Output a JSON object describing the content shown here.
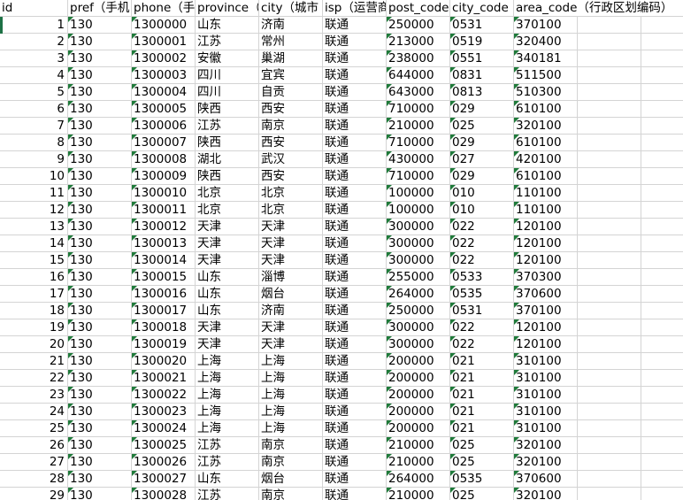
{
  "columns": [
    {
      "key": "id",
      "label": "id"
    },
    {
      "key": "pref",
      "label": "pref（手机"
    },
    {
      "key": "phone",
      "label": "phone（手"
    },
    {
      "key": "province",
      "label": "province（"
    },
    {
      "key": "city",
      "label": "city（城市"
    },
    {
      "key": "isp",
      "label": "isp（运营商"
    },
    {
      "key": "post_code",
      "label": "post_code"
    },
    {
      "key": "city_code",
      "label": "city_code（"
    },
    {
      "key": "area_code",
      "label": "area_code（行政区划编码）"
    },
    {
      "key": "extra1",
      "label": ""
    },
    {
      "key": "extra2",
      "label": ""
    }
  ],
  "rows": [
    [
      "1",
      "130",
      "1300000",
      "山东",
      "济南",
      "联通",
      "250000",
      "0531",
      "370100"
    ],
    [
      "2",
      "130",
      "1300001",
      "江苏",
      "常州",
      "联通",
      "213000",
      "0519",
      "320400"
    ],
    [
      "3",
      "130",
      "1300002",
      "安徽",
      "巢湖",
      "联通",
      "238000",
      "0551",
      "340181"
    ],
    [
      "4",
      "130",
      "1300003",
      "四川",
      "宜宾",
      "联通",
      "644000",
      "0831",
      "511500"
    ],
    [
      "5",
      "130",
      "1300004",
      "四川",
      "自贡",
      "联通",
      "643000",
      "0813",
      "510300"
    ],
    [
      "6",
      "130",
      "1300005",
      "陕西",
      "西安",
      "联通",
      "710000",
      "029",
      "610100"
    ],
    [
      "7",
      "130",
      "1300006",
      "江苏",
      "南京",
      "联通",
      "210000",
      "025",
      "320100"
    ],
    [
      "8",
      "130",
      "1300007",
      "陕西",
      "西安",
      "联通",
      "710000",
      "029",
      "610100"
    ],
    [
      "9",
      "130",
      "1300008",
      "湖北",
      "武汉",
      "联通",
      "430000",
      "027",
      "420100"
    ],
    [
      "10",
      "130",
      "1300009",
      "陕西",
      "西安",
      "联通",
      "710000",
      "029",
      "610100"
    ],
    [
      "11",
      "130",
      "1300010",
      "北京",
      "北京",
      "联通",
      "100000",
      "010",
      "110100"
    ],
    [
      "12",
      "130",
      "1300011",
      "北京",
      "北京",
      "联通",
      "100000",
      "010",
      "110100"
    ],
    [
      "13",
      "130",
      "1300012",
      "天津",
      "天津",
      "联通",
      "300000",
      "022",
      "120100"
    ],
    [
      "14",
      "130",
      "1300013",
      "天津",
      "天津",
      "联通",
      "300000",
      "022",
      "120100"
    ],
    [
      "15",
      "130",
      "1300014",
      "天津",
      "天津",
      "联通",
      "300000",
      "022",
      "120100"
    ],
    [
      "16",
      "130",
      "1300015",
      "山东",
      "淄博",
      "联通",
      "255000",
      "0533",
      "370300"
    ],
    [
      "17",
      "130",
      "1300016",
      "山东",
      "烟台",
      "联通",
      "264000",
      "0535",
      "370600"
    ],
    [
      "18",
      "130",
      "1300017",
      "山东",
      "济南",
      "联通",
      "250000",
      "0531",
      "370100"
    ],
    [
      "19",
      "130",
      "1300018",
      "天津",
      "天津",
      "联通",
      "300000",
      "022",
      "120100"
    ],
    [
      "20",
      "130",
      "1300019",
      "天津",
      "天津",
      "联通",
      "300000",
      "022",
      "120100"
    ],
    [
      "21",
      "130",
      "1300020",
      "上海",
      "上海",
      "联通",
      "200000",
      "021",
      "310100"
    ],
    [
      "22",
      "130",
      "1300021",
      "上海",
      "上海",
      "联通",
      "200000",
      "021",
      "310100"
    ],
    [
      "23",
      "130",
      "1300022",
      "上海",
      "上海",
      "联通",
      "200000",
      "021",
      "310100"
    ],
    [
      "24",
      "130",
      "1300023",
      "上海",
      "上海",
      "联通",
      "200000",
      "021",
      "310100"
    ],
    [
      "25",
      "130",
      "1300024",
      "上海",
      "上海",
      "联通",
      "200000",
      "021",
      "310100"
    ],
    [
      "26",
      "130",
      "1300025",
      "江苏",
      "南京",
      "联通",
      "210000",
      "025",
      "320100"
    ],
    [
      "27",
      "130",
      "1300026",
      "江苏",
      "南京",
      "联通",
      "210000",
      "025",
      "320100"
    ],
    [
      "28",
      "130",
      "1300027",
      "山东",
      "烟台",
      "联通",
      "264000",
      "0535",
      "370600"
    ],
    [
      "29",
      "130",
      "1300028",
      "江苏",
      "南京",
      "联通",
      "210000",
      "025",
      "320100"
    ]
  ],
  "text_marker_columns": [
    1,
    2,
    6,
    7,
    8
  ],
  "marker_color": "#1f7a3a",
  "gridline_color": "#d4d4d4"
}
